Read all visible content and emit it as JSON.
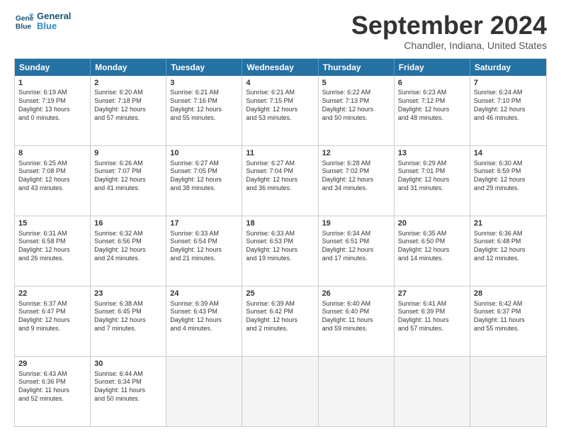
{
  "header": {
    "logo_line1": "General",
    "logo_line2": "Blue",
    "month": "September 2024",
    "location": "Chandler, Indiana, United States"
  },
  "days_of_week": [
    "Sunday",
    "Monday",
    "Tuesday",
    "Wednesday",
    "Thursday",
    "Friday",
    "Saturday"
  ],
  "weeks": [
    [
      {
        "day": "1",
        "info": "Sunrise: 6:19 AM\nSunset: 7:19 PM\nDaylight: 13 hours\nand 0 minutes."
      },
      {
        "day": "2",
        "info": "Sunrise: 6:20 AM\nSunset: 7:18 PM\nDaylight: 12 hours\nand 57 minutes."
      },
      {
        "day": "3",
        "info": "Sunrise: 6:21 AM\nSunset: 7:16 PM\nDaylight: 12 hours\nand 55 minutes."
      },
      {
        "day": "4",
        "info": "Sunrise: 6:21 AM\nSunset: 7:15 PM\nDaylight: 12 hours\nand 53 minutes."
      },
      {
        "day": "5",
        "info": "Sunrise: 6:22 AM\nSunset: 7:13 PM\nDaylight: 12 hours\nand 50 minutes."
      },
      {
        "day": "6",
        "info": "Sunrise: 6:23 AM\nSunset: 7:12 PM\nDaylight: 12 hours\nand 48 minutes."
      },
      {
        "day": "7",
        "info": "Sunrise: 6:24 AM\nSunset: 7:10 PM\nDaylight: 12 hours\nand 46 minutes."
      }
    ],
    [
      {
        "day": "8",
        "info": "Sunrise: 6:25 AM\nSunset: 7:08 PM\nDaylight: 12 hours\nand 43 minutes."
      },
      {
        "day": "9",
        "info": "Sunrise: 6:26 AM\nSunset: 7:07 PM\nDaylight: 12 hours\nand 41 minutes."
      },
      {
        "day": "10",
        "info": "Sunrise: 6:27 AM\nSunset: 7:05 PM\nDaylight: 12 hours\nand 38 minutes."
      },
      {
        "day": "11",
        "info": "Sunrise: 6:27 AM\nSunset: 7:04 PM\nDaylight: 12 hours\nand 36 minutes."
      },
      {
        "day": "12",
        "info": "Sunrise: 6:28 AM\nSunset: 7:02 PM\nDaylight: 12 hours\nand 34 minutes."
      },
      {
        "day": "13",
        "info": "Sunrise: 6:29 AM\nSunset: 7:01 PM\nDaylight: 12 hours\nand 31 minutes."
      },
      {
        "day": "14",
        "info": "Sunrise: 6:30 AM\nSunset: 6:59 PM\nDaylight: 12 hours\nand 29 minutes."
      }
    ],
    [
      {
        "day": "15",
        "info": "Sunrise: 6:31 AM\nSunset: 6:58 PM\nDaylight: 12 hours\nand 26 minutes."
      },
      {
        "day": "16",
        "info": "Sunrise: 6:32 AM\nSunset: 6:56 PM\nDaylight: 12 hours\nand 24 minutes."
      },
      {
        "day": "17",
        "info": "Sunrise: 6:33 AM\nSunset: 6:54 PM\nDaylight: 12 hours\nand 21 minutes."
      },
      {
        "day": "18",
        "info": "Sunrise: 6:33 AM\nSunset: 6:53 PM\nDaylight: 12 hours\nand 19 minutes."
      },
      {
        "day": "19",
        "info": "Sunrise: 6:34 AM\nSunset: 6:51 PM\nDaylight: 12 hours\nand 17 minutes."
      },
      {
        "day": "20",
        "info": "Sunrise: 6:35 AM\nSunset: 6:50 PM\nDaylight: 12 hours\nand 14 minutes."
      },
      {
        "day": "21",
        "info": "Sunrise: 6:36 AM\nSunset: 6:48 PM\nDaylight: 12 hours\nand 12 minutes."
      }
    ],
    [
      {
        "day": "22",
        "info": "Sunrise: 6:37 AM\nSunset: 6:47 PM\nDaylight: 12 hours\nand 9 minutes."
      },
      {
        "day": "23",
        "info": "Sunrise: 6:38 AM\nSunset: 6:45 PM\nDaylight: 12 hours\nand 7 minutes."
      },
      {
        "day": "24",
        "info": "Sunrise: 6:39 AM\nSunset: 6:43 PM\nDaylight: 12 hours\nand 4 minutes."
      },
      {
        "day": "25",
        "info": "Sunrise: 6:39 AM\nSunset: 6:42 PM\nDaylight: 12 hours\nand 2 minutes."
      },
      {
        "day": "26",
        "info": "Sunrise: 6:40 AM\nSunset: 6:40 PM\nDaylight: 11 hours\nand 59 minutes."
      },
      {
        "day": "27",
        "info": "Sunrise: 6:41 AM\nSunset: 6:39 PM\nDaylight: 11 hours\nand 57 minutes."
      },
      {
        "day": "28",
        "info": "Sunrise: 6:42 AM\nSunset: 6:37 PM\nDaylight: 11 hours\nand 55 minutes."
      }
    ],
    [
      {
        "day": "29",
        "info": "Sunrise: 6:43 AM\nSunset: 6:36 PM\nDaylight: 11 hours\nand 52 minutes."
      },
      {
        "day": "30",
        "info": "Sunrise: 6:44 AM\nSunset: 6:34 PM\nDaylight: 11 hours\nand 50 minutes."
      },
      {
        "day": "",
        "info": ""
      },
      {
        "day": "",
        "info": ""
      },
      {
        "day": "",
        "info": ""
      },
      {
        "day": "",
        "info": ""
      },
      {
        "day": "",
        "info": ""
      }
    ]
  ]
}
